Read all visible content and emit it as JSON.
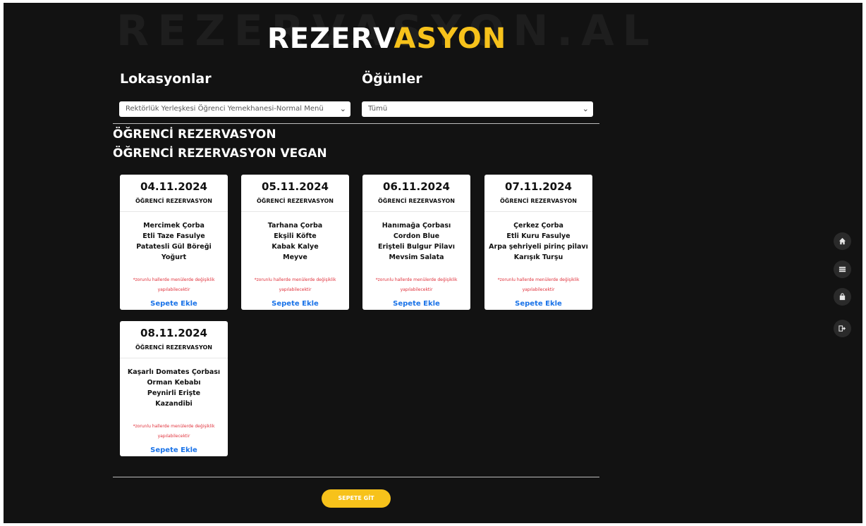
{
  "header": {
    "background_word": "REZERVASYON.AL",
    "logo_part1": "REZERV",
    "logo_part2": "ASYON"
  },
  "filters": {
    "locations_label": "Lokasyonlar",
    "location_value": "Rektörlük Yerleşkesi Öğrenci Yemekhanesi-Normal Menü",
    "meals_label": "Öğünler",
    "meal_value": "Tümü"
  },
  "categories": [
    "ÖĞRENCİ REZERVASYON",
    "ÖĞRENCİ REZERVASYON VEGAN"
  ],
  "cards": [
    {
      "date": "04.11.2024",
      "type": "ÖĞRENCİ REZERVASYON",
      "items": [
        "Mercimek Çorba",
        "Etli Taze Fasulye",
        "Patatesli Gül Böreği",
        "Yoğurt"
      ],
      "note": "*zorunlu hallerde menülerde değişiklik yapılabilecektir",
      "action": "Sepete Ekle"
    },
    {
      "date": "05.11.2024",
      "type": "ÖĞRENCİ REZERVASYON",
      "items": [
        "Tarhana Çorba",
        "Ekşili Köfte",
        "Kabak Kalye",
        "Meyve"
      ],
      "note": "*zorunlu hallerde menülerde değişiklik yapılabilecektir",
      "action": "Sepete Ekle"
    },
    {
      "date": "06.11.2024",
      "type": "ÖĞRENCİ REZERVASYON",
      "items": [
        "Hanımağa Çorbası",
        "Cordon Blue",
        "Erişteli Bulgur Pilavı",
        "Mevsim Salata"
      ],
      "note": "*zorunlu hallerde menülerde değişiklik yapılabilecektir",
      "action": "Sepete Ekle"
    },
    {
      "date": "07.11.2024",
      "type": "ÖĞRENCİ REZERVASYON",
      "items": [
        "Çerkez Çorba",
        "Etli Kuru Fasulye",
        "Arpa şehriyeli pirinç pilavı",
        "Karışık Turşu"
      ],
      "note": "*zorunlu hallerde menülerde değişiklik yapılabilecektir",
      "action": "Sepete Ekle"
    },
    {
      "date": "08.11.2024",
      "type": "ÖĞRENCİ REZERVASYON",
      "items": [
        "Kaşarlı Domates Çorbası",
        "Orman Kebabı",
        "Peynirli Erişte",
        "Kazandibi"
      ],
      "note": "*zorunlu hallerde menülerde değişiklik yapılabilecektir",
      "action": "Sepete Ekle"
    }
  ],
  "cart_button": "SEPETE GİT",
  "side_nav": [
    "home-icon",
    "list-icon",
    "bag-icon",
    "logout-icon"
  ],
  "colors": {
    "accent": "#f7c21b",
    "background": "#121212",
    "link": "#1a73e8",
    "note": "#e0303a"
  }
}
